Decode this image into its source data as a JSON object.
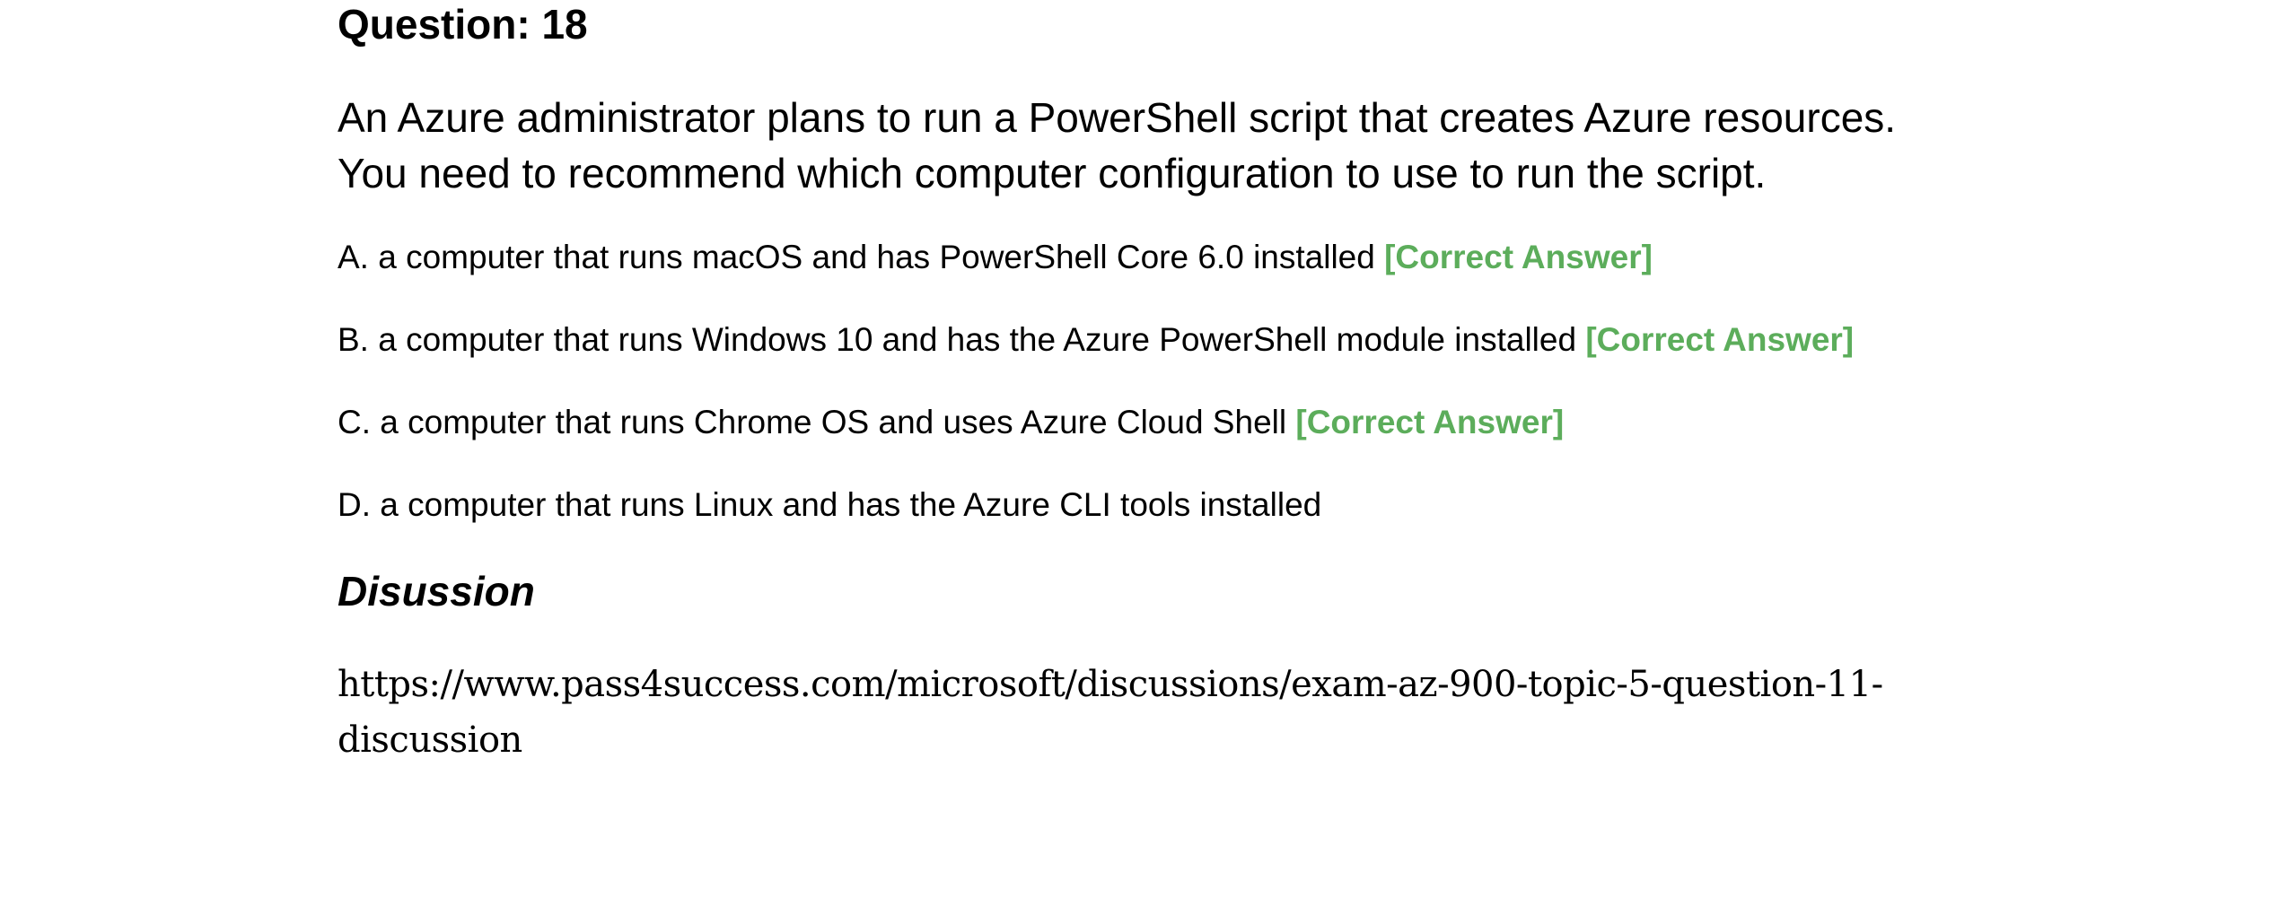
{
  "question": {
    "title": "Question: 18",
    "text_line1": "An Azure administrator plans to run a PowerShell script that creates Azure resources.",
    "text_line2": "You need to recommend which computer configuration to use to run the script."
  },
  "options": [
    {
      "text": "A. a computer that runs macOS and has PowerShell Core 6.0 installed",
      "marker": "[Correct Answer]"
    },
    {
      "text": "B. a computer that runs Windows 10 and has the Azure PowerShell module installed",
      "marker": "[Correct Answer]"
    },
    {
      "text": "C. a computer that runs Chrome OS and uses Azure Cloud Shell",
      "marker": "[Correct Answer]"
    },
    {
      "text": "D. a computer that runs Linux and has the Azure CLI tools installed"
    }
  ],
  "discussion": {
    "heading": "Disussion",
    "link_line1": "https://www.pass4success.com/microsoft/discussions/exam-az-900-topic-5-question-11-",
    "link_line2": "discussion"
  },
  "colors": {
    "correct_marker": "#5cad5b",
    "text": "#000000",
    "background": "#ffffff"
  }
}
